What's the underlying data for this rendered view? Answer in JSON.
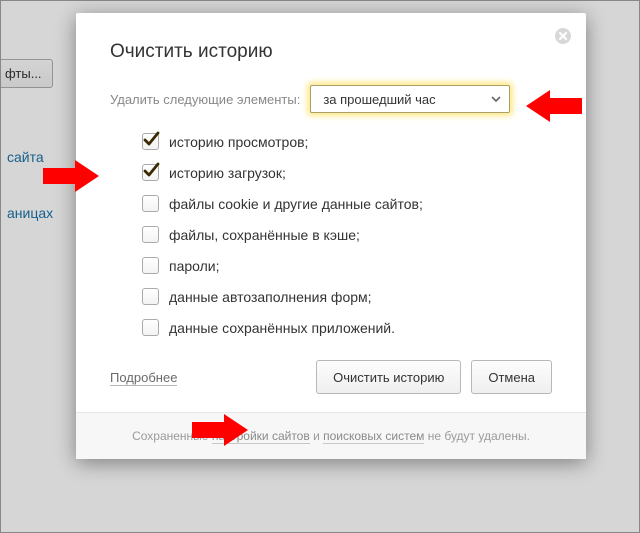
{
  "underlay": {
    "fonts_button": "фты...",
    "link_site": "сайта",
    "link_pages": "аницах"
  },
  "dialog": {
    "title": "Очистить историю",
    "range_label": "Удалить следующие элементы:",
    "range_value": "за прошедший час",
    "items": [
      {
        "label": "историю просмотров;",
        "checked": true
      },
      {
        "label": "историю загрузок;",
        "checked": true
      },
      {
        "label": "файлы cookie и другие данные сайтов;",
        "checked": false
      },
      {
        "label": "файлы, сохранённые в кэше;",
        "checked": false
      },
      {
        "label": "пароли;",
        "checked": false
      },
      {
        "label": "данные автозаполнения форм;",
        "checked": false
      },
      {
        "label": "данные сохранённых приложений.",
        "checked": false
      }
    ],
    "details": "Подробнее",
    "clear_button": "Очистить историю",
    "cancel_button": "Отмена"
  },
  "footer": {
    "pre": "Сохраненные ",
    "link1": "настройки сайтов",
    "mid": " и ",
    "link2": "поисковых систем",
    "post": " не будут удалены."
  }
}
